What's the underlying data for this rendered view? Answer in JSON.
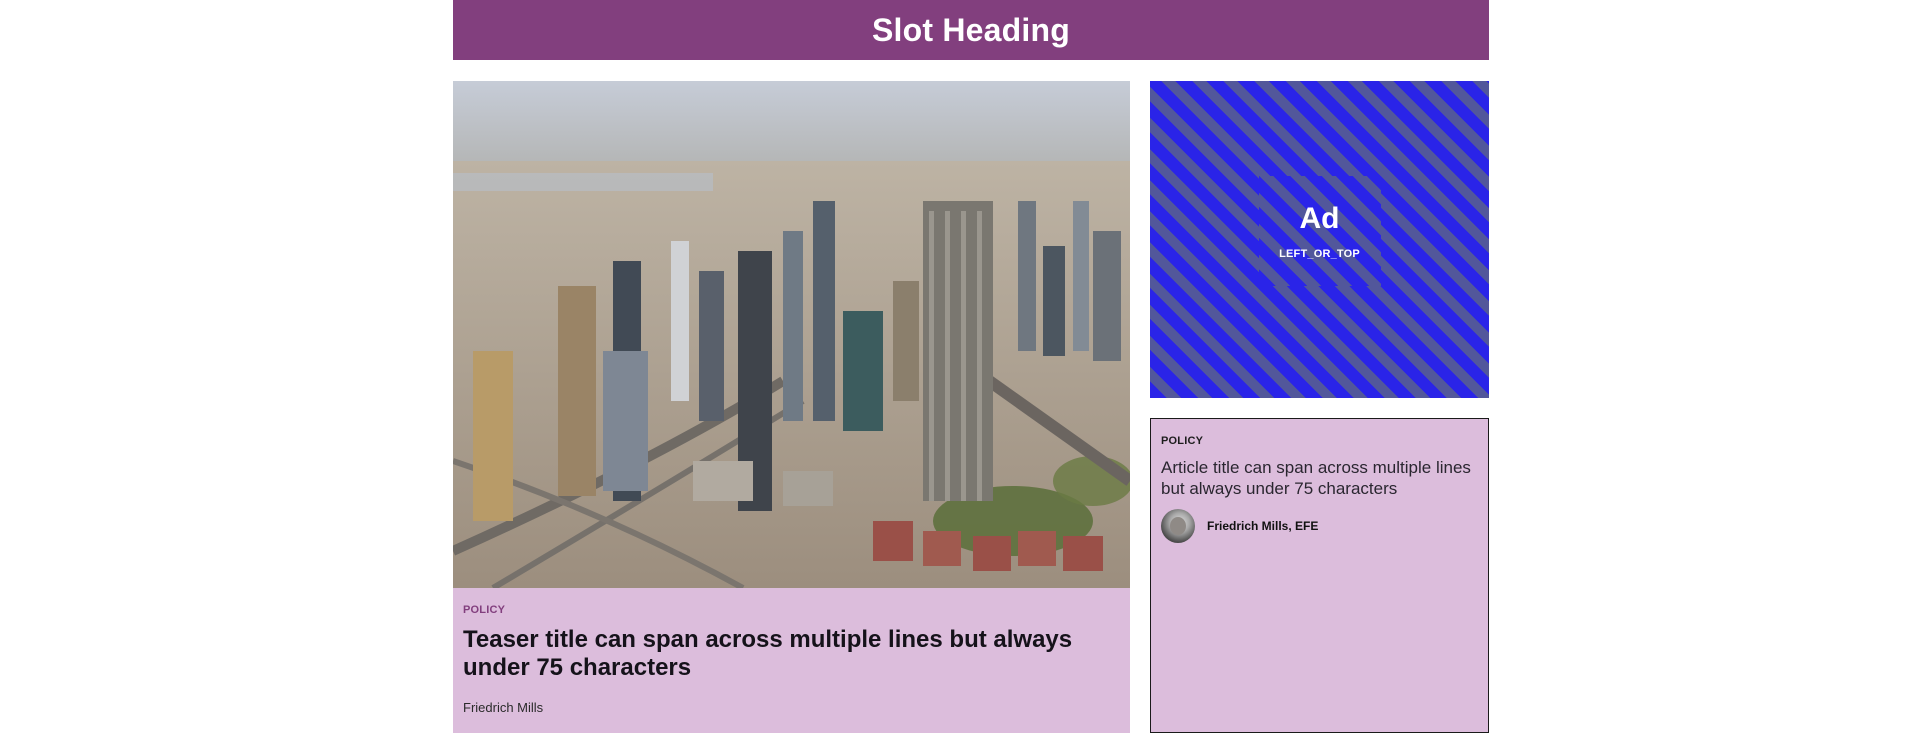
{
  "slot": {
    "heading": "Slot Heading"
  },
  "teaser": {
    "kicker": "POLICY",
    "title": "Teaser title can span across multiple lines but always under 75 characters",
    "author": "Friedrich Mills",
    "image_alt": "Aerial view of a city skyline with skyscrapers and highways"
  },
  "ad": {
    "label": "Ad",
    "slot_name": "LEFT_OR_TOP"
  },
  "article": {
    "kicker": "POLICY",
    "title": "Article title can span across multiple lines but always under 75 characters",
    "author": "Friedrich Mills, EFE"
  },
  "colors": {
    "brand": "#823f7e",
    "card_background": "#dcbddc",
    "ad_stripe_a": "#2a24e8",
    "ad_stripe_b": "#52579b"
  }
}
